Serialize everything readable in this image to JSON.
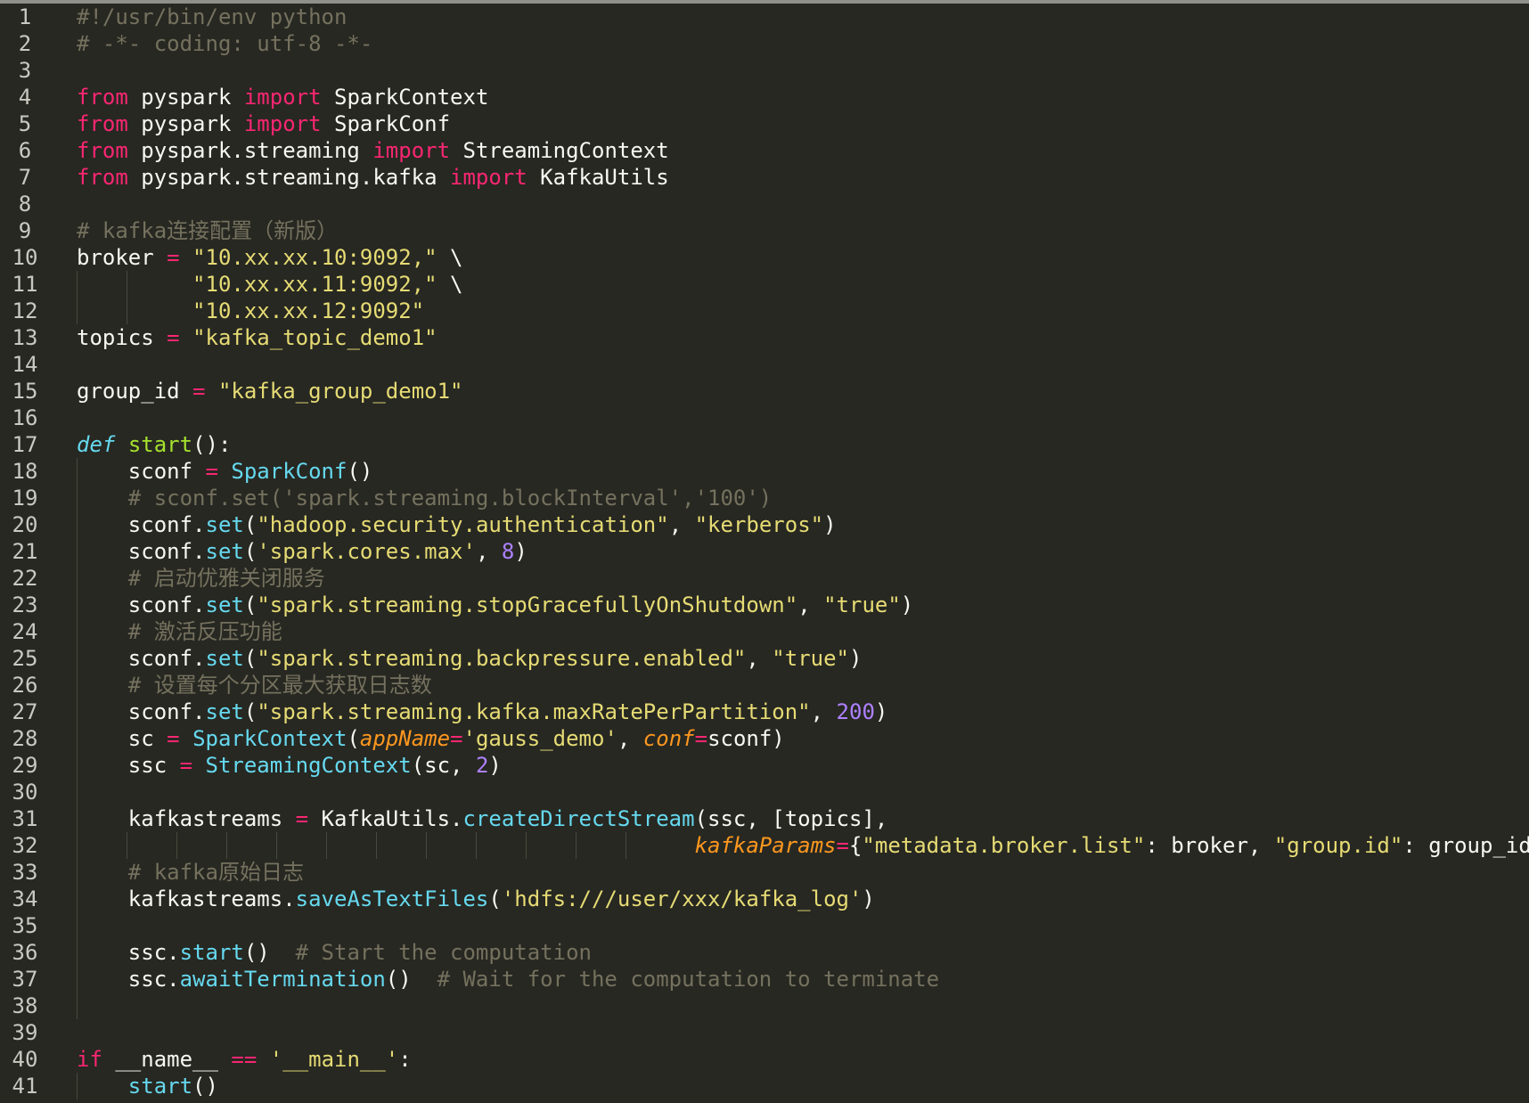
{
  "editor": {
    "theme_colors": {
      "background": "#272822",
      "keyword": "#f92672",
      "string": "#e6db74",
      "comment": "#75715e",
      "function": "#66d9ef",
      "def_name": "#a6e22e",
      "number": "#ae81ff",
      "parameter": "#fd971f"
    },
    "lines": [
      {
        "n": "1",
        "guides": 0,
        "tokens": [
          {
            "t": "#!/usr/bin/env python",
            "c": "cmt"
          }
        ]
      },
      {
        "n": "2",
        "guides": 0,
        "tokens": [
          {
            "t": "# -*- coding: utf-8 -*-",
            "c": "cmt"
          }
        ]
      },
      {
        "n": "3",
        "guides": 0,
        "tokens": []
      },
      {
        "n": "4",
        "guides": 0,
        "tokens": [
          {
            "t": "from",
            "c": "kw"
          },
          {
            "t": " pyspark ",
            "c": ""
          },
          {
            "t": "import",
            "c": "kw"
          },
          {
            "t": " SparkContext",
            "c": ""
          }
        ]
      },
      {
        "n": "5",
        "guides": 0,
        "tokens": [
          {
            "t": "from",
            "c": "kw"
          },
          {
            "t": " pyspark ",
            "c": ""
          },
          {
            "t": "import",
            "c": "kw"
          },
          {
            "t": " SparkConf",
            "c": ""
          }
        ]
      },
      {
        "n": "6",
        "guides": 0,
        "tokens": [
          {
            "t": "from",
            "c": "kw"
          },
          {
            "t": " pyspark.streaming ",
            "c": ""
          },
          {
            "t": "import",
            "c": "kw"
          },
          {
            "t": " StreamingContext",
            "c": ""
          }
        ]
      },
      {
        "n": "7",
        "guides": 0,
        "tokens": [
          {
            "t": "from",
            "c": "kw"
          },
          {
            "t": " pyspark.streaming.kafka ",
            "c": ""
          },
          {
            "t": "import",
            "c": "kw"
          },
          {
            "t": " KafkaUtils",
            "c": ""
          }
        ]
      },
      {
        "n": "8",
        "guides": 0,
        "tokens": []
      },
      {
        "n": "9",
        "guides": 0,
        "tokens": [
          {
            "t": "# kafka连接配置（新版）",
            "c": "cmt"
          }
        ]
      },
      {
        "n": "10",
        "guides": 0,
        "tokens": [
          {
            "t": "broker ",
            "c": ""
          },
          {
            "t": "=",
            "c": "op"
          },
          {
            "t": " ",
            "c": ""
          },
          {
            "t": "\"10.xx.xx.10:9092,\"",
            "c": "str"
          },
          {
            "t": " \\",
            "c": ""
          }
        ]
      },
      {
        "n": "11",
        "guides": 2,
        "tokens": [
          {
            "t": "         ",
            "c": ""
          },
          {
            "t": "\"10.xx.xx.11:9092,\"",
            "c": "str"
          },
          {
            "t": " \\",
            "c": ""
          }
        ]
      },
      {
        "n": "12",
        "guides": 2,
        "tokens": [
          {
            "t": "         ",
            "c": ""
          },
          {
            "t": "\"10.xx.xx.12:9092\"",
            "c": "str"
          }
        ]
      },
      {
        "n": "13",
        "guides": 0,
        "tokens": [
          {
            "t": "topics ",
            "c": ""
          },
          {
            "t": "=",
            "c": "op"
          },
          {
            "t": " ",
            "c": ""
          },
          {
            "t": "\"kafka_topic_demo1\"",
            "c": "str"
          }
        ]
      },
      {
        "n": "14",
        "guides": 0,
        "tokens": []
      },
      {
        "n": "15",
        "guides": 0,
        "tokens": [
          {
            "t": "group_id ",
            "c": ""
          },
          {
            "t": "=",
            "c": "op"
          },
          {
            "t": " ",
            "c": ""
          },
          {
            "t": "\"kafka_group_demo1\"",
            "c": "str"
          }
        ]
      },
      {
        "n": "16",
        "guides": 0,
        "tokens": []
      },
      {
        "n": "17",
        "guides": 0,
        "tokens": [
          {
            "t": "def",
            "c": "def"
          },
          {
            "t": " ",
            "c": ""
          },
          {
            "t": "start",
            "c": "fname"
          },
          {
            "t": "():",
            "c": ""
          }
        ]
      },
      {
        "n": "18",
        "guides": 1,
        "tokens": [
          {
            "t": "    sconf ",
            "c": ""
          },
          {
            "t": "=",
            "c": "op"
          },
          {
            "t": " ",
            "c": ""
          },
          {
            "t": "SparkConf",
            "c": "fn"
          },
          {
            "t": "()",
            "c": ""
          }
        ]
      },
      {
        "n": "19",
        "guides": 1,
        "tokens": [
          {
            "t": "    ",
            "c": ""
          },
          {
            "t": "# sconf.set('spark.streaming.blockInterval','100')",
            "c": "cmt"
          }
        ]
      },
      {
        "n": "20",
        "guides": 1,
        "tokens": [
          {
            "t": "    sconf.",
            "c": ""
          },
          {
            "t": "set",
            "c": "fn"
          },
          {
            "t": "(",
            "c": ""
          },
          {
            "t": "\"hadoop.security.authentication\"",
            "c": "str"
          },
          {
            "t": ", ",
            "c": ""
          },
          {
            "t": "\"kerberos\"",
            "c": "str"
          },
          {
            "t": ")",
            "c": ""
          }
        ]
      },
      {
        "n": "21",
        "guides": 1,
        "tokens": [
          {
            "t": "    sconf.",
            "c": ""
          },
          {
            "t": "set",
            "c": "fn"
          },
          {
            "t": "(",
            "c": ""
          },
          {
            "t": "'spark.cores.max'",
            "c": "str"
          },
          {
            "t": ", ",
            "c": ""
          },
          {
            "t": "8",
            "c": "num"
          },
          {
            "t": ")",
            "c": ""
          }
        ]
      },
      {
        "n": "22",
        "guides": 1,
        "tokens": [
          {
            "t": "    ",
            "c": ""
          },
          {
            "t": "# 启动优雅关闭服务",
            "c": "cmt"
          }
        ]
      },
      {
        "n": "23",
        "guides": 1,
        "tokens": [
          {
            "t": "    sconf.",
            "c": ""
          },
          {
            "t": "set",
            "c": "fn"
          },
          {
            "t": "(",
            "c": ""
          },
          {
            "t": "\"spark.streaming.stopGracefullyOnShutdown\"",
            "c": "str"
          },
          {
            "t": ", ",
            "c": ""
          },
          {
            "t": "\"true\"",
            "c": "str"
          },
          {
            "t": ")",
            "c": ""
          }
        ]
      },
      {
        "n": "24",
        "guides": 1,
        "tokens": [
          {
            "t": "    ",
            "c": ""
          },
          {
            "t": "# 激活反压功能",
            "c": "cmt"
          }
        ]
      },
      {
        "n": "25",
        "guides": 1,
        "tokens": [
          {
            "t": "    sconf.",
            "c": ""
          },
          {
            "t": "set",
            "c": "fn"
          },
          {
            "t": "(",
            "c": ""
          },
          {
            "t": "\"spark.streaming.backpressure.enabled\"",
            "c": "str"
          },
          {
            "t": ", ",
            "c": ""
          },
          {
            "t": "\"true\"",
            "c": "str"
          },
          {
            "t": ")",
            "c": ""
          }
        ]
      },
      {
        "n": "26",
        "guides": 1,
        "tokens": [
          {
            "t": "    ",
            "c": ""
          },
          {
            "t": "# 设置每个分区最大获取日志数",
            "c": "cmt"
          }
        ]
      },
      {
        "n": "27",
        "guides": 1,
        "tokens": [
          {
            "t": "    sconf.",
            "c": ""
          },
          {
            "t": "set",
            "c": "fn"
          },
          {
            "t": "(",
            "c": ""
          },
          {
            "t": "\"spark.streaming.kafka.maxRatePerPartition\"",
            "c": "str"
          },
          {
            "t": ", ",
            "c": ""
          },
          {
            "t": "200",
            "c": "num"
          },
          {
            "t": ")",
            "c": ""
          }
        ]
      },
      {
        "n": "28",
        "guides": 1,
        "tokens": [
          {
            "t": "    sc ",
            "c": ""
          },
          {
            "t": "=",
            "c": "op"
          },
          {
            "t": " ",
            "c": ""
          },
          {
            "t": "SparkContext",
            "c": "fn"
          },
          {
            "t": "(",
            "c": ""
          },
          {
            "t": "appName",
            "c": "param"
          },
          {
            "t": "=",
            "c": "op"
          },
          {
            "t": "'gauss_demo'",
            "c": "str"
          },
          {
            "t": ", ",
            "c": ""
          },
          {
            "t": "conf",
            "c": "param"
          },
          {
            "t": "=",
            "c": "op"
          },
          {
            "t": "sconf)",
            "c": ""
          }
        ]
      },
      {
        "n": "29",
        "guides": 1,
        "tokens": [
          {
            "t": "    ssc ",
            "c": ""
          },
          {
            "t": "=",
            "c": "op"
          },
          {
            "t": " ",
            "c": ""
          },
          {
            "t": "StreamingContext",
            "c": "fn"
          },
          {
            "t": "(sc, ",
            "c": ""
          },
          {
            "t": "2",
            "c": "num"
          },
          {
            "t": ")",
            "c": ""
          }
        ]
      },
      {
        "n": "30",
        "guides": 1,
        "tokens": []
      },
      {
        "n": "31",
        "guides": 1,
        "tokens": [
          {
            "t": "    kafkastreams ",
            "c": ""
          },
          {
            "t": "=",
            "c": "op"
          },
          {
            "t": " KafkaUtils.",
            "c": ""
          },
          {
            "t": "createDirectStream",
            "c": "fn"
          },
          {
            "t": "(ssc, [topics],",
            "c": ""
          }
        ]
      },
      {
        "n": "32",
        "guides": 12,
        "tokens": [
          {
            "t": "                                                ",
            "c": ""
          },
          {
            "t": "kafkaParams",
            "c": "param"
          },
          {
            "t": "=",
            "c": "op"
          },
          {
            "t": "{",
            "c": ""
          },
          {
            "t": "\"metadata.broker.list\"",
            "c": "str"
          },
          {
            "t": ": broker, ",
            "c": ""
          },
          {
            "t": "\"group.id\"",
            "c": "str"
          },
          {
            "t": ": group_id})",
            "c": ""
          }
        ]
      },
      {
        "n": "33",
        "guides": 1,
        "tokens": [
          {
            "t": "    ",
            "c": ""
          },
          {
            "t": "# kafka原始日志",
            "c": "cmt"
          }
        ]
      },
      {
        "n": "34",
        "guides": 1,
        "tokens": [
          {
            "t": "    kafkastreams.",
            "c": ""
          },
          {
            "t": "saveAsTextFiles",
            "c": "fn"
          },
          {
            "t": "(",
            "c": ""
          },
          {
            "t": "'hdfs:///user/xxx/kafka_log'",
            "c": "str"
          },
          {
            "t": ")",
            "c": ""
          }
        ]
      },
      {
        "n": "35",
        "guides": 1,
        "tokens": []
      },
      {
        "n": "36",
        "guides": 1,
        "tokens": [
          {
            "t": "    ssc.",
            "c": ""
          },
          {
            "t": "start",
            "c": "fn"
          },
          {
            "t": "()  ",
            "c": ""
          },
          {
            "t": "# Start the computation",
            "c": "cmt"
          }
        ]
      },
      {
        "n": "37",
        "guides": 1,
        "tokens": [
          {
            "t": "    ssc.",
            "c": ""
          },
          {
            "t": "awaitTermination",
            "c": "fn"
          },
          {
            "t": "()  ",
            "c": ""
          },
          {
            "t": "# Wait for the computation to terminate",
            "c": "cmt"
          }
        ]
      },
      {
        "n": "38",
        "guides": 1,
        "tokens": []
      },
      {
        "n": "39",
        "guides": 0,
        "tokens": []
      },
      {
        "n": "40",
        "guides": 0,
        "tokens": [
          {
            "t": "if",
            "c": "kw"
          },
          {
            "t": " __name__ ",
            "c": ""
          },
          {
            "t": "==",
            "c": "op"
          },
          {
            "t": " ",
            "c": ""
          },
          {
            "t": "'__main__'",
            "c": "str"
          },
          {
            "t": ":",
            "c": ""
          }
        ]
      },
      {
        "n": "41",
        "guides": 1,
        "tokens": [
          {
            "t": "    ",
            "c": ""
          },
          {
            "t": "start",
            "c": "fn"
          },
          {
            "t": "()",
            "c": ""
          }
        ]
      }
    ]
  }
}
